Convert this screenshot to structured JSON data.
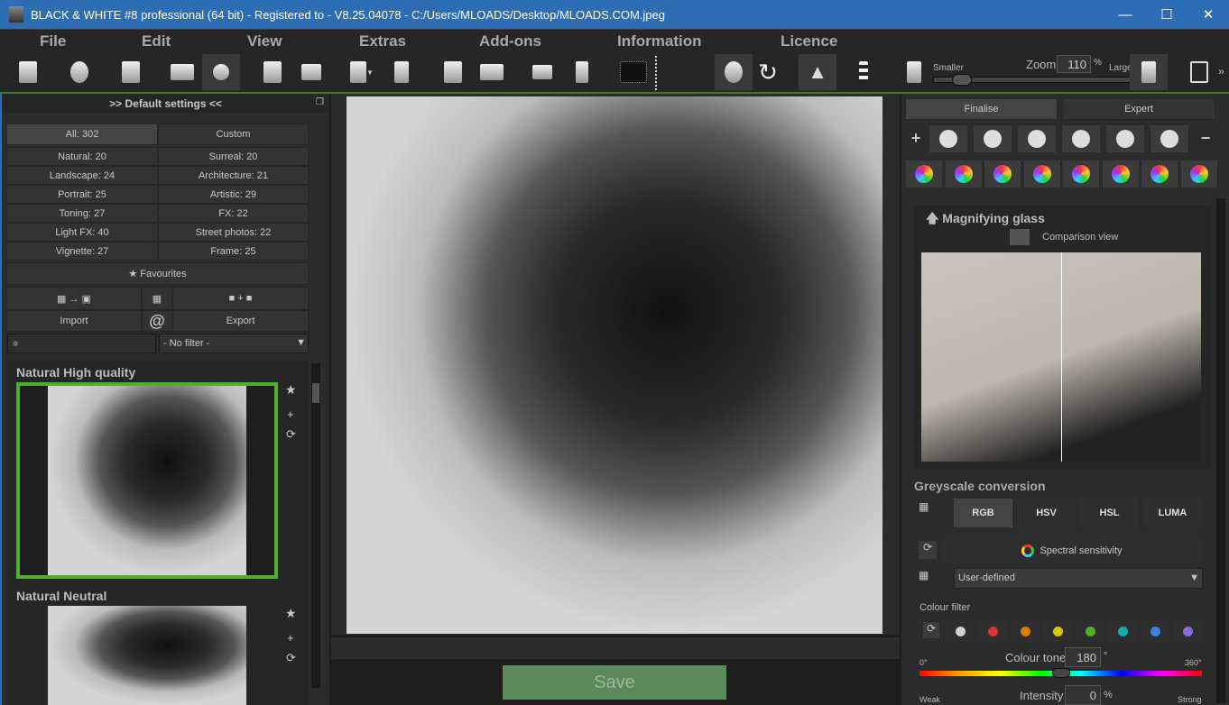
{
  "window": {
    "title": "BLACK & WHITE #8 professional (64 bit) - Registered to - V8.25.04078 - C:/Users/MLOADS/Desktop/MLOADS.COM.jpeg",
    "minimize": "—",
    "maximize": "☐",
    "close": "✕"
  },
  "menu": [
    "File",
    "Edit",
    "View",
    "Extras",
    "Add-ons",
    "Information",
    "Licence"
  ],
  "toolbar": {
    "icons": [
      "new-file-icon",
      "history-icon",
      "batch-icon",
      "raw-icon",
      "settings-icon",
      "save-icon",
      "print-icon",
      "export-dropdown-icon",
      "share-icon",
      "save-as-icon",
      "compare-icon",
      "split-view-icon",
      "info-icon",
      "histogram-icon",
      "reset-rotate-icon",
      "redo-icon",
      "mirror-icon",
      "dither-icon",
      "smaller-icon",
      "larger-icon",
      "crop-rotate-icon"
    ],
    "zoom_label": "Zoom",
    "zoom_value": "110",
    "zoom_unit": "%",
    "smaller": "Smaller",
    "larger": "Larger",
    "more": "»",
    "zoom_slider_fraction": 0.12
  },
  "left": {
    "header": ">> Default settings <<",
    "tabs": [
      "All: 302",
      "Custom"
    ],
    "categories": [
      [
        "Natural: 20",
        "Surreal: 20"
      ],
      [
        "Landscape: 24",
        "Architecture: 21"
      ],
      [
        "Portrait: 25",
        "Artistic: 29"
      ],
      [
        "Toning: 27",
        "FX: 22"
      ],
      [
        "Light FX: 40",
        "Street photos: 22"
      ],
      [
        "Vignette: 27",
        "Frame: 25"
      ]
    ],
    "favourites": "Favourites",
    "import": "Import",
    "export": "Export",
    "at": "@",
    "search_placeholder": "",
    "filter": "- No filter -",
    "presets": [
      {
        "name": "Natural High quality",
        "selected": true
      },
      {
        "name": "Natural Neutral",
        "selected": false
      }
    ],
    "star": "★",
    "plus": "+",
    "reload": "⟳"
  },
  "center": {
    "save": "Save"
  },
  "right": {
    "tabs": [
      "Finalise",
      "Expert"
    ],
    "plus": "+",
    "minus": "−",
    "magnifier": {
      "title": "Magnifying glass",
      "comparison": "Comparison view"
    },
    "greyscale": {
      "title": "Greyscale conversion",
      "modes": [
        "RGB",
        "HSV",
        "HSL",
        "LUMA"
      ],
      "spectral": "Spectral sensitivity",
      "preset": "User-defined",
      "colour_filter": "Colour filter",
      "filter_colors": [
        "#d0d0d0",
        "#e03030",
        "#e07a00",
        "#d8c800",
        "#50b020",
        "#10b0b0",
        "#3a80e8",
        "#8a6ae0"
      ],
      "tone_label": "Colour tone",
      "tone_value": "180",
      "tone_unit": "°",
      "tone_min": "0°",
      "tone_max": "360°",
      "intensity_label": "Intensity",
      "intensity_value": "0",
      "intensity_unit": "%",
      "weak": "Weak",
      "strong": "Strong"
    }
  }
}
